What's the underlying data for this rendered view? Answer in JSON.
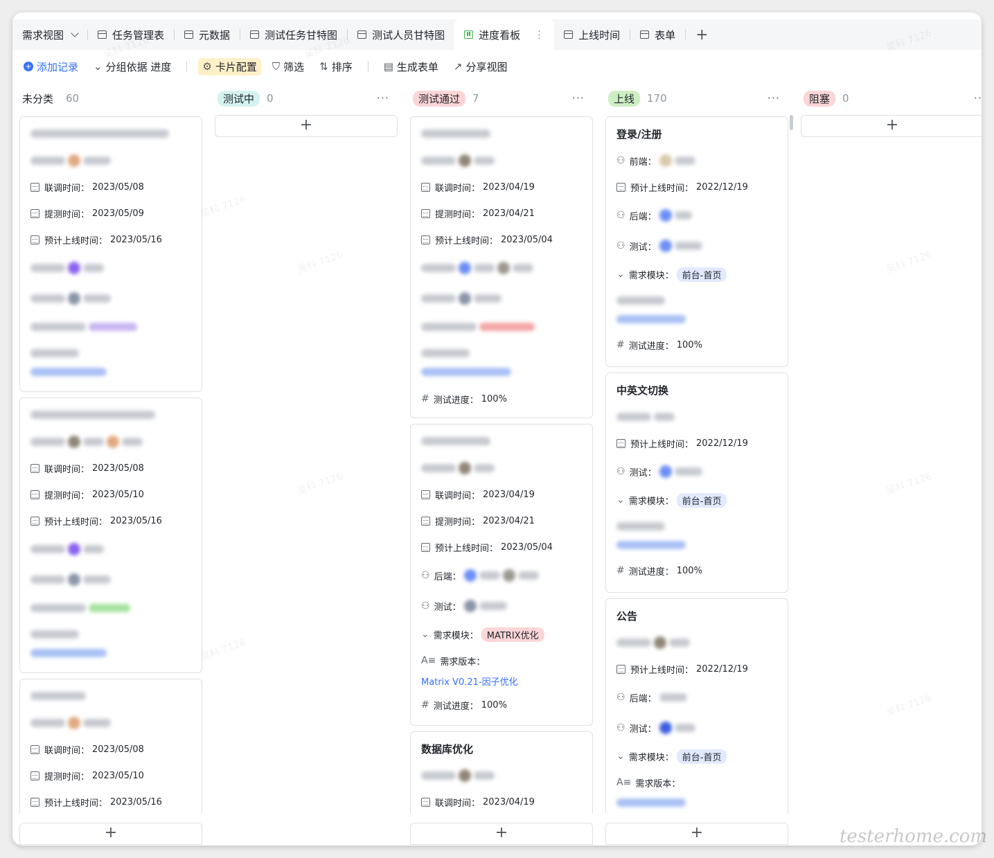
{
  "tabs": {
    "view": "需求视图",
    "items": [
      "任务管理表",
      "元数据",
      "测试任务甘特图",
      "测试人员甘特图",
      "进度看板",
      "上线时间",
      "表单"
    ],
    "plus": "+"
  },
  "toolbar": {
    "add": "添加记录",
    "group": "分组依据 进度",
    "card": "卡片配置",
    "filter": "筛选",
    "sort": "排序",
    "form": "生成表单",
    "share": "分享视图"
  },
  "columns": [
    {
      "name": "未分类",
      "count": "60",
      "color": "#ffffff",
      "text": "#1f2329"
    },
    {
      "name": "测试中",
      "count": "0",
      "color": "#d4f3f0",
      "text": "#1f2329"
    },
    {
      "name": "测试通过",
      "count": "7",
      "color": "#fcd6d6",
      "text": "#1f2329"
    },
    {
      "name": "上线",
      "count": "170",
      "color": "#cdeec2",
      "text": "#1f2329"
    },
    {
      "name": "阻塞",
      "count": "0",
      "color": "#fcd6d6",
      "text": "#1f2329"
    }
  ],
  "labels": {
    "liantiao": "联调时间：",
    "tice": "提测时间：",
    "yuji": "预计上线时间：",
    "qianduan": "前端：",
    "houduan": "后端：",
    "ceshi": "测试：",
    "mokuai": "需求模块：",
    "banben": "需求版本：",
    "jindu": "测试进度："
  },
  "col0": [
    {
      "d1": "2023/05/08",
      "d2": "2023/05/09",
      "d3": "2023/05/16"
    },
    {
      "d1": "2023/05/08",
      "d2": "2023/05/10",
      "d3": "2023/05/16"
    },
    {
      "d1": "2023/05/08",
      "d2": "2023/05/10",
      "d3": "2023/05/16"
    }
  ],
  "col2": [
    {
      "d1": "2023/04/19",
      "d2": "2023/04/21",
      "d3": "2023/05/04",
      "progress": "100%"
    },
    {
      "d1": "2023/04/19",
      "d2": "2023/04/21",
      "d3": "2023/05/04",
      "module": "MATRIX优化",
      "version": "Matrix V0.21-因子优化",
      "progress": "100%"
    },
    {
      "title": "数据库优化",
      "d1": "2023/04/19"
    }
  ],
  "col3": [
    {
      "title": "登录/注册",
      "d3": "2022/12/19",
      "module": "前台-首页",
      "progress": "100%"
    },
    {
      "title": "中英文切换",
      "d3": "2022/12/19",
      "module": "前台-首页",
      "progress": "100%"
    },
    {
      "title": "公告",
      "d3": "2022/12/19",
      "module": "前台-首页"
    }
  ],
  "watermark": "吴科 7126",
  "footer": "testerhome.com"
}
